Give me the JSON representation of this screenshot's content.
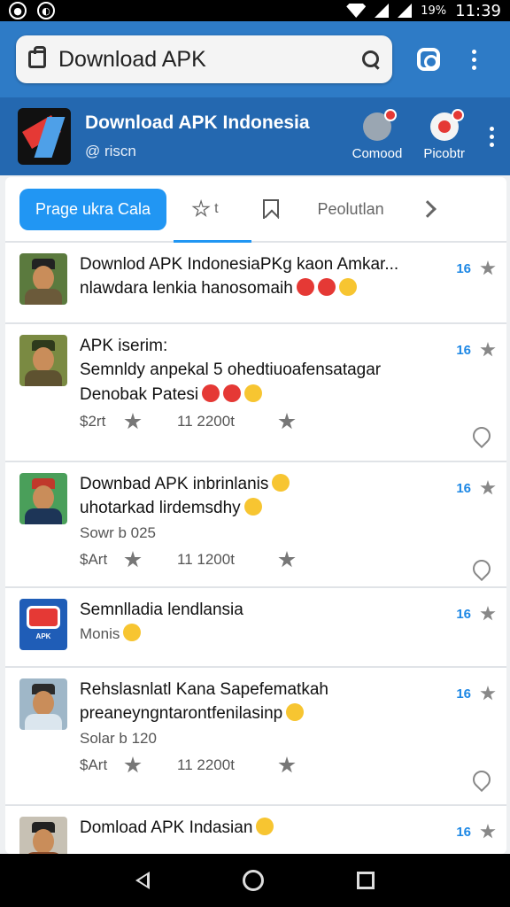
{
  "status": {
    "battery": "19%",
    "time": "11:39"
  },
  "browser": {
    "url": "Download APK"
  },
  "app": {
    "title": "Download APK Indonesia",
    "subtitle": "@ riscn",
    "action1": "Comood",
    "action2": "Picobtr"
  },
  "tabs": {
    "active": "Prage ukra Cala",
    "star_label": "t",
    "text": "Peolutlan"
  },
  "items": [
    {
      "title": "Downlod APK IndonesiaPKg kaon Amkar...",
      "line1": "nlawdara lenkia hanosomaih",
      "like": "16"
    },
    {
      "title": "APK iserim:",
      "line1": "Semnldy anpekal 5 ohedtiuoafensatagar",
      "line2": "Denobak Patesi",
      "count": "$2rt",
      "date": "11 2200t",
      "like": "16"
    },
    {
      "title": "Downbad APK inbrinlanis",
      "line1": "uhotarkad lirdemsdhy",
      "meta": "Sowr b 025",
      "count": "$Art",
      "date": "11 1200t",
      "like": "16"
    },
    {
      "title": "Semnlladia lendlansia",
      "meta": "Monis",
      "like": "16"
    },
    {
      "title": "Rehslasnlatl Kana Sapefematkah",
      "line1": "preaneyngntarontfenilasinp",
      "meta": "Solar b 120",
      "count": "$Art",
      "date": "11 2200t",
      "like": "16"
    },
    {
      "title": "Domload APK Indasian",
      "like": "16"
    }
  ]
}
